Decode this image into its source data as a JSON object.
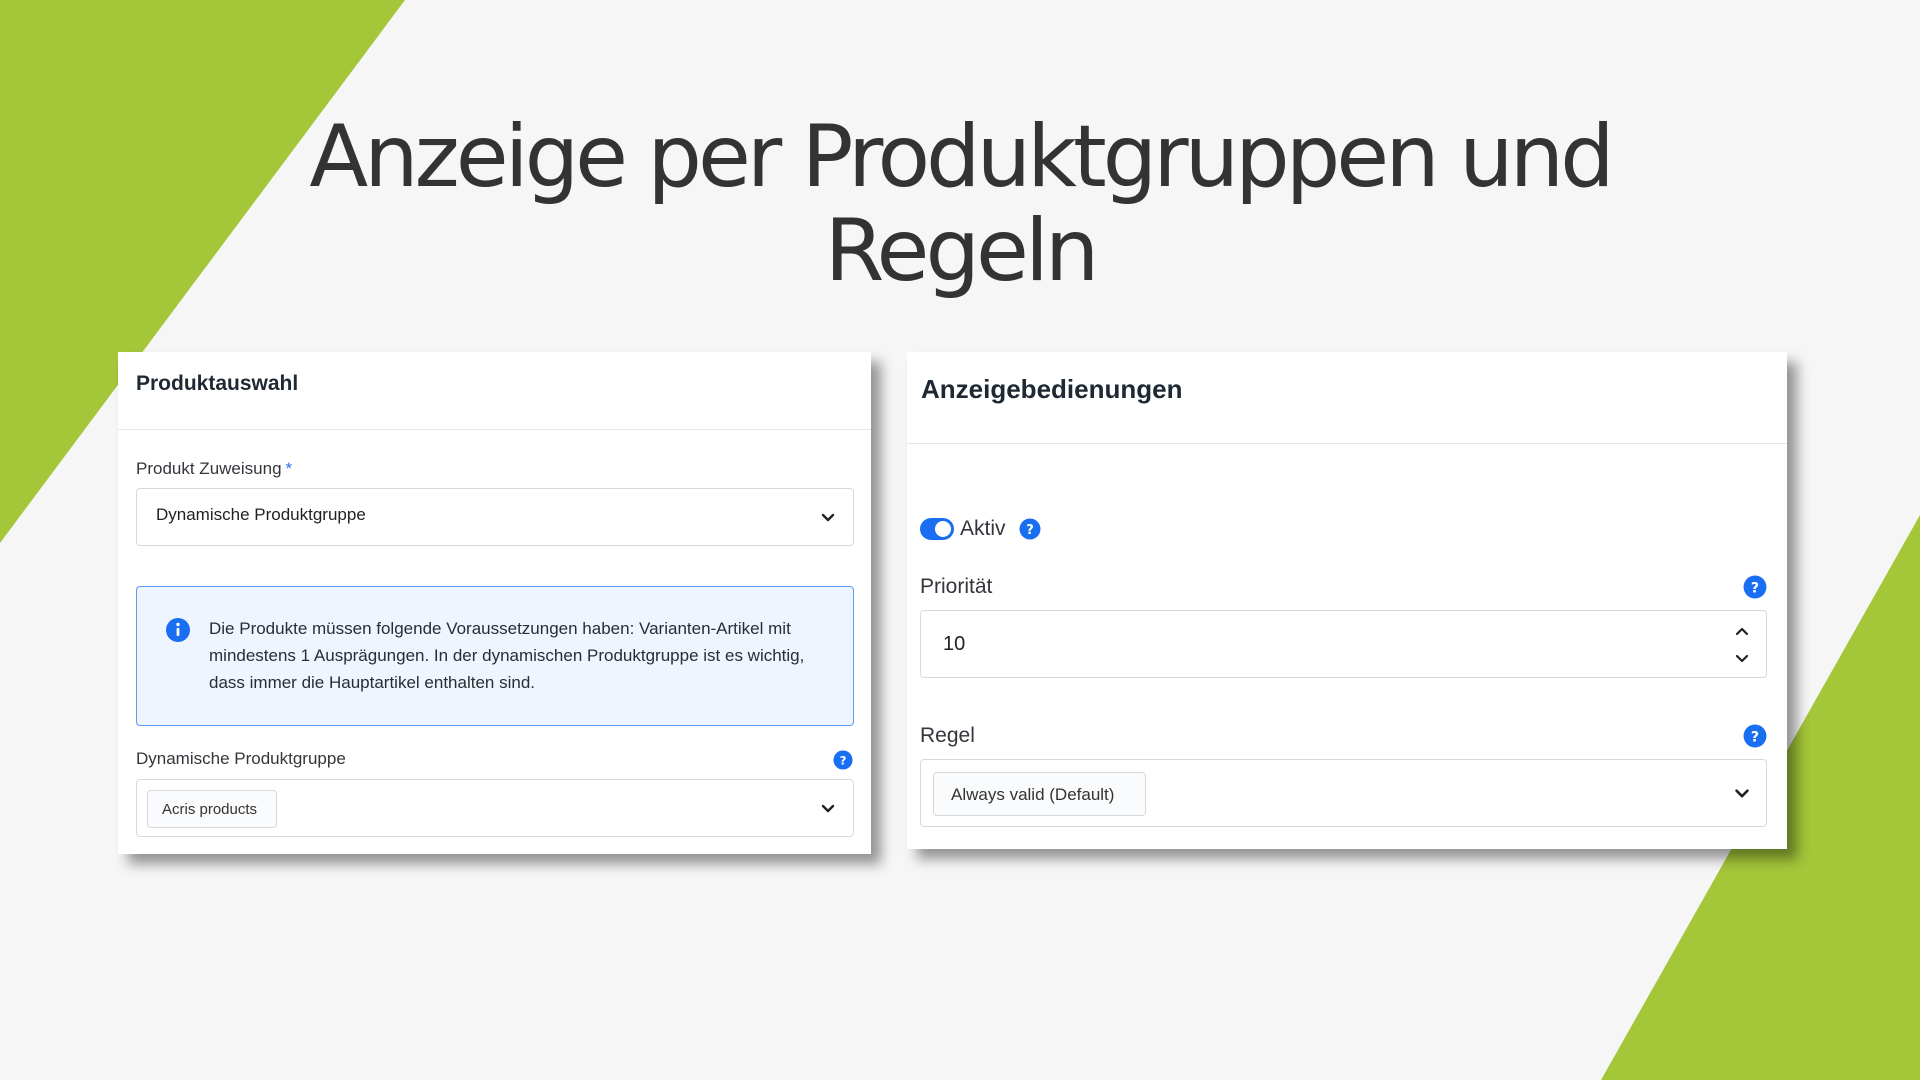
{
  "slide": {
    "title_line1": "Anzeige per Produktgruppen und",
    "title_line2": "Regeln"
  },
  "colors": {
    "accent_green": "#a4c639",
    "primary_blue": "#1a6ef2",
    "info_bg": "#eef5ff",
    "info_border": "#5b9bf0"
  },
  "product_selection": {
    "heading": "Produktauswahl",
    "assignment_label": "Produkt Zuweisung",
    "required_marker": "*",
    "assignment_value": "Dynamische Produktgruppe",
    "info_text": "Die Produkte müssen folgende Voraussetzungen haben: Varianten-Artikel mit mindestens 1 Ausprägungen. In der dynamischen Produktgruppe ist es wichtig, dass immer die Hauptartikel enthalten sind.",
    "group_label": "Dynamische Produktgruppe",
    "group_tag": "Acris products"
  },
  "display_conditions": {
    "heading": "Anzeigebedienungen",
    "active_label": "Aktiv",
    "active": true,
    "priority_label": "Priorität",
    "priority_value": "10",
    "rule_label": "Regel",
    "rule_tag": "Always valid (Default)"
  },
  "icons": {
    "info": "info-icon",
    "help": "question-icon",
    "dropdown": "chevron-down-icon",
    "stepper_up": "chevron-up-icon",
    "stepper_down": "chevron-down-icon"
  }
}
